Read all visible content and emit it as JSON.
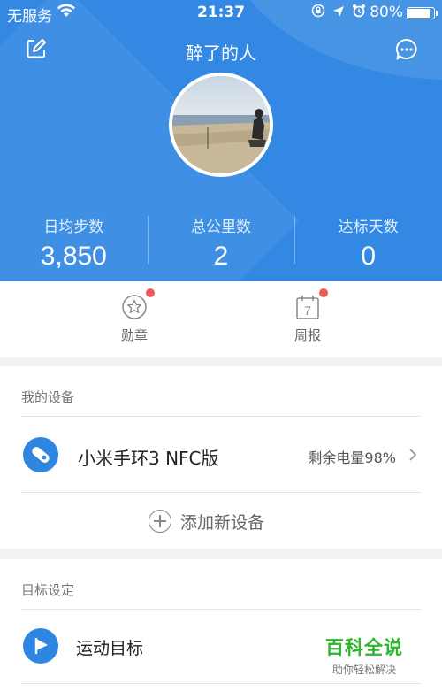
{
  "status_bar": {
    "carrier": "无服务",
    "time": "21:37",
    "battery": "80%"
  },
  "header": {
    "title": "醉了的人"
  },
  "stats": [
    {
      "label": "日均步数",
      "value": "3,850"
    },
    {
      "label": "总公里数",
      "value": "2"
    },
    {
      "label": "达标天数",
      "value": "0"
    }
  ],
  "shortcuts": {
    "medals": "勋章",
    "weekly_report": "周报",
    "calendar_day": "7"
  },
  "devices": {
    "section_title": "我的设备",
    "device_name": "小米手环3 NFC版",
    "battery_text": "剩余电量98%",
    "add_label": "添加新设备"
  },
  "goals": {
    "section_title": "目标设定",
    "item_label": "运动目标"
  },
  "watermark": {
    "main": "百科全说",
    "sub": "助你轻松解决"
  },
  "colors": {
    "header_blue": "#3388e3",
    "accent_blue": "#2f86e0",
    "notification_red": "#f05a5a"
  }
}
